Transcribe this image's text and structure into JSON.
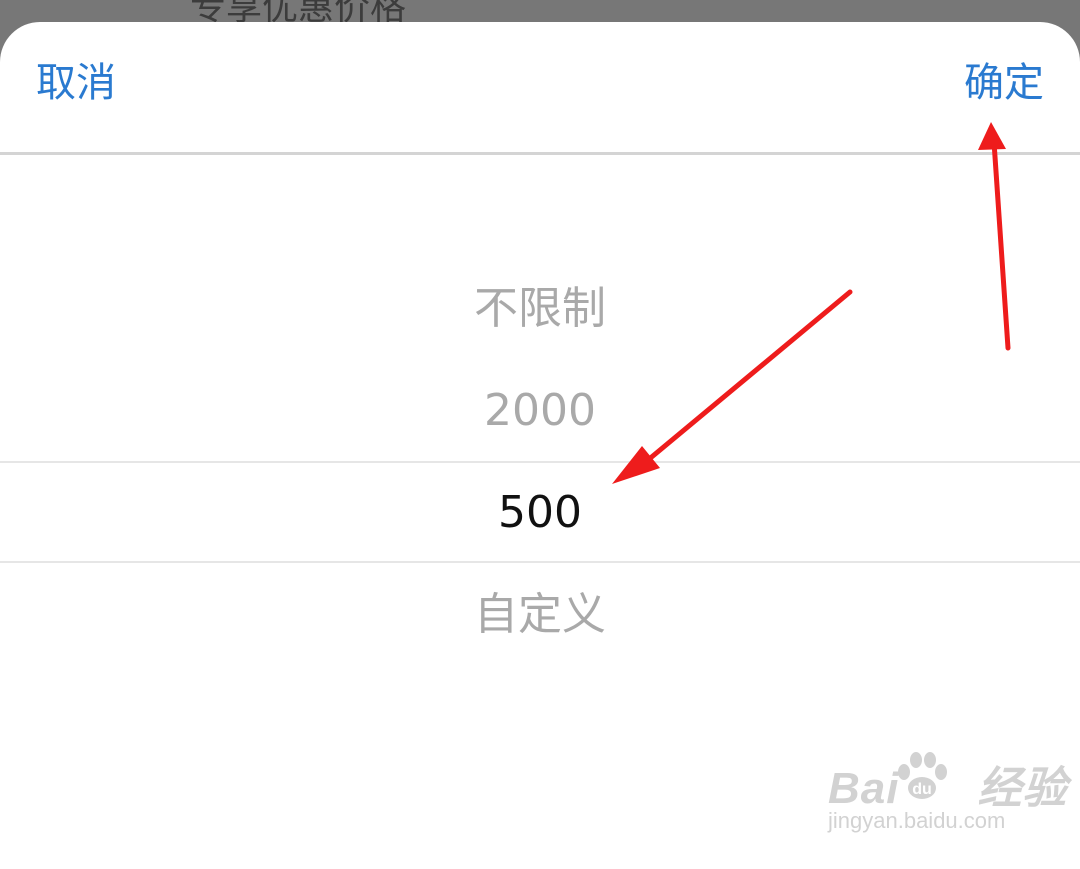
{
  "backdrop": {
    "partial_text": "专享优惠价格"
  },
  "toolbar": {
    "cancel_label": "取消",
    "confirm_label": "确定",
    "accent_color": "#2a7ad0"
  },
  "picker": {
    "options": [
      "不限制",
      "2000",
      "500",
      "自定义"
    ],
    "selected_index": 2,
    "selected_value": "500"
  },
  "annotation": {
    "arrow_color": "#ee1c1c"
  },
  "watermark": {
    "logo_text": "Bai  经验",
    "url": "jingyan.baidu.com"
  }
}
